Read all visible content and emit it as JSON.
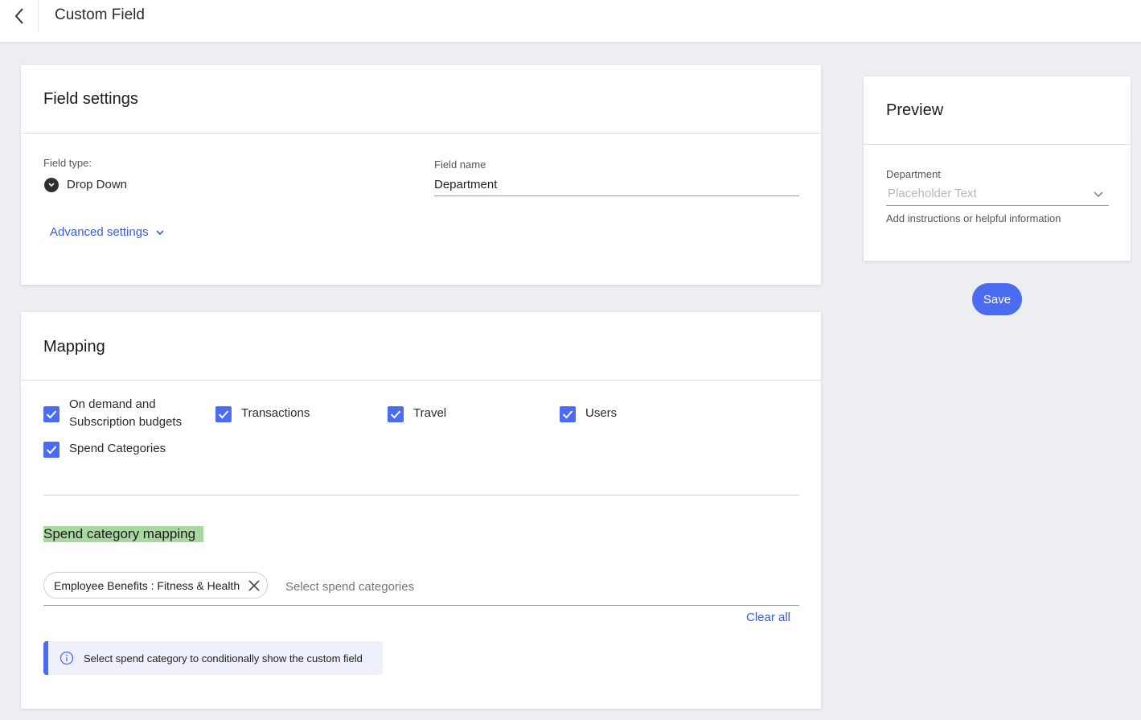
{
  "header": {
    "title": "Custom Field"
  },
  "field_settings": {
    "title": "Field settings",
    "field_type_label": "Field type:",
    "field_type_value": "Drop Down",
    "field_name_label": "Field name",
    "field_name_value": "Department",
    "advanced_settings_label": "Advanced settings"
  },
  "mapping": {
    "title": "Mapping",
    "checkboxes": [
      {
        "label_line1": "On demand and",
        "label_line2": "Subscription budgets",
        "checked": true
      },
      {
        "label": "Transactions",
        "checked": true
      },
      {
        "label": "Travel",
        "checked": true
      },
      {
        "label": "Users",
        "checked": true
      },
      {
        "label": "Spend Categories",
        "checked": true
      }
    ],
    "spend_category_title": "Spend category mapping",
    "selected_chip": "Employee Benefits : Fitness & Health",
    "select_placeholder": "Select spend categories",
    "clear_all_label": "Clear all",
    "info_text": "Select spend category to conditionally show the custom field"
  },
  "preview": {
    "title": "Preview",
    "field_label": "Department",
    "placeholder": "Placeholder Text",
    "helper_text": "Add instructions or helpful information"
  },
  "actions": {
    "save_label": "Save"
  },
  "colors": {
    "accent": "#4b6cf0",
    "link": "#3a5ae0",
    "highlight": "#a9d7a0",
    "background": "#eceef2"
  }
}
